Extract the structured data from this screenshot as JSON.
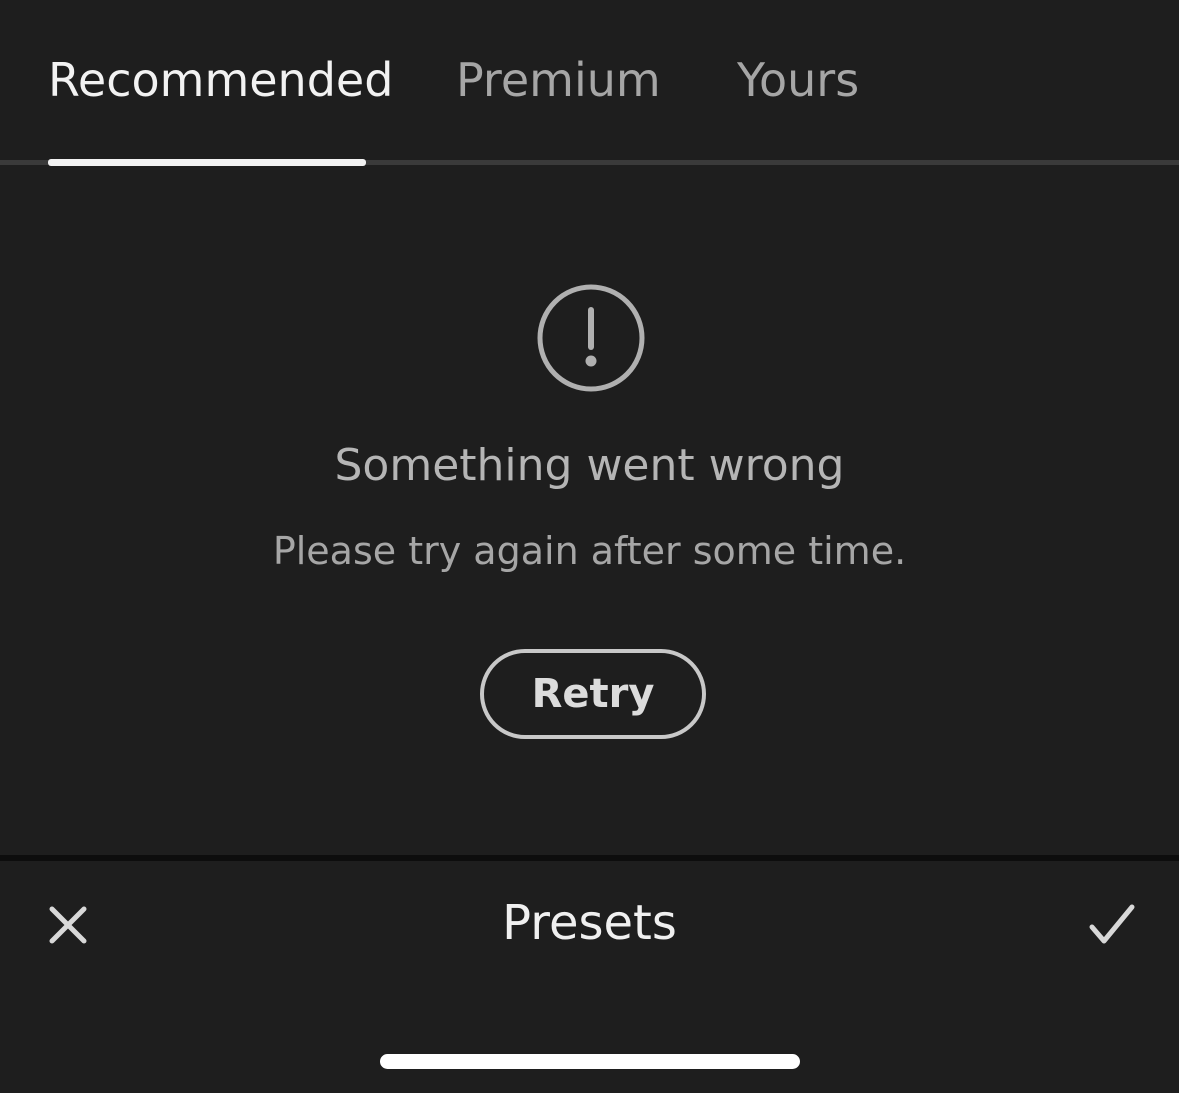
{
  "tabs": {
    "items": [
      {
        "label": "Recommended",
        "active": true
      },
      {
        "label": "Premium",
        "active": false
      },
      {
        "label": "Yours",
        "active": false
      }
    ]
  },
  "error": {
    "icon": "exclamation-circle-icon",
    "title": "Something went wrong",
    "message": "Please try again after some time.",
    "retry_label": "Retry"
  },
  "bottom_bar": {
    "title": "Presets",
    "close_icon": "close-icon",
    "confirm_icon": "checkmark-icon"
  },
  "colors": {
    "background": "#1e1e1e",
    "active_text": "#f2f2f2",
    "inactive_text": "#a6a6a6"
  }
}
